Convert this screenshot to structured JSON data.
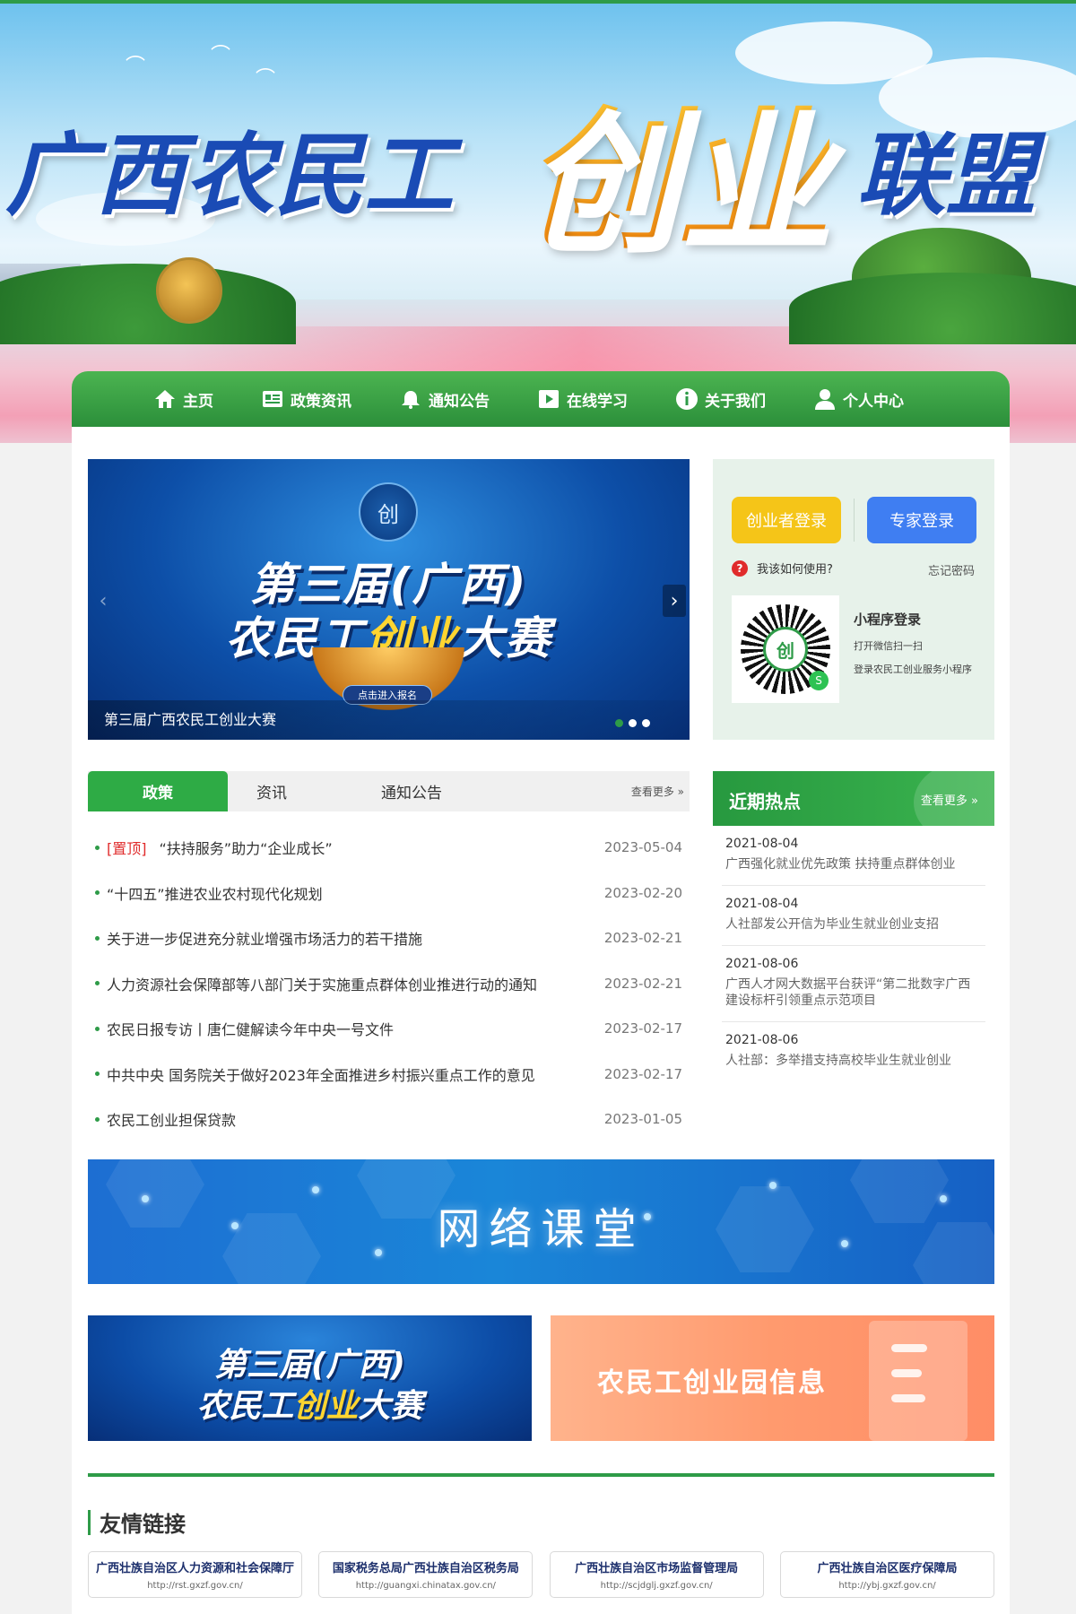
{
  "banner": {
    "title_blue_1": "广西农民工",
    "title_orange": "创业",
    "title_blue_2": "联盟"
  },
  "nav": {
    "items": [
      {
        "label": "主页",
        "icon": "home-icon"
      },
      {
        "label": "政策资讯",
        "icon": "news-icon"
      },
      {
        "label": "通知公告",
        "icon": "bell-icon"
      },
      {
        "label": "在线学习",
        "icon": "play-icon"
      },
      {
        "label": "关于我们",
        "icon": "info-icon"
      },
      {
        "label": "个人中心",
        "icon": "user-icon"
      }
    ]
  },
  "carousel": {
    "line1": "第三届(广西)",
    "line2_a": "农民工",
    "line2_b": "创业",
    "line2_c": "大赛",
    "enter_btn": "点击进入报名",
    "caption": "第三届广西农民工创业大赛",
    "slides": 3,
    "active_slide": 1
  },
  "login": {
    "entrepreneur_btn": "创业者登录",
    "expert_btn": "专家登录",
    "help": "我该如何使用?",
    "forgot": "忘记密码",
    "mini_title": "小程序登录",
    "mini_line1": "打开微信扫一扫",
    "mini_line2": "登录农民工创业服务小程序"
  },
  "tabs": {
    "items": [
      "政策",
      "资讯",
      "通知公告"
    ],
    "active": 0,
    "more": "查看更多 »"
  },
  "news": [
    {
      "pinned": "[置顶]",
      "title": "“扶持服务”助力“企业成长”",
      "date": "2023-05-04"
    },
    {
      "pinned": "",
      "title": "“十四五”推进农业农村现代化规划",
      "date": "2023-02-20"
    },
    {
      "pinned": "",
      "title": "关于进一步促进充分就业增强市场活力的若干措施",
      "date": "2023-02-21"
    },
    {
      "pinned": "",
      "title": "人力资源社会保障部等八部门关于实施重点群体创业推进行动的通知",
      "date": "2023-02-21"
    },
    {
      "pinned": "",
      "title": "农民日报专访丨唐仁健解读今年中央一号文件",
      "date": "2023-02-17"
    },
    {
      "pinned": "",
      "title": "中共中央 国务院关于做好2023年全面推进乡村振兴重点工作的意见",
      "date": "2023-02-17"
    },
    {
      "pinned": "",
      "title": "农民工创业担保贷款",
      "date": "2023-01-05"
    }
  ],
  "hot": {
    "title": "近期热点",
    "more": "查看更多 »",
    "items": [
      {
        "date": "2021-08-04",
        "title": "广西强化就业优先政策 扶持重点群体创业"
      },
      {
        "date": "2021-08-04",
        "title": "人社部发公开信为毕业生就业创业支招"
      },
      {
        "date": "2021-08-06",
        "title": "广西人才网大数据平台获评“第二批数字广西建设标杆引领重点示范项目"
      },
      {
        "date": "2021-08-06",
        "title": "人社部：多举措支持高校毕业生就业创业"
      }
    ]
  },
  "classroom": {
    "label": "网络课堂"
  },
  "contest_banner": {
    "line1": "第三届(广西)",
    "line2_a": "农民工",
    "line2_b": "创业",
    "line2_c": "大赛"
  },
  "park_banner": {
    "label": "农民工创业园信息"
  },
  "friend_links": {
    "title": "友情链接",
    "items": [
      {
        "name": "广西壮族自治区人力资源和社会保障厅",
        "url": "http://rst.gxzf.gov.cn/"
      },
      {
        "name": "国家税务总局广西壮族自治区税务局",
        "url": "http://guangxi.chinatax.gov.cn/"
      },
      {
        "name": "广西壮族自治区市场监督管理局",
        "url": "http://scjdglj.gxzf.gov.cn/"
      },
      {
        "name": "广西壮族自治区医疗保障局",
        "url": "http://ybj.gxzf.gov.cn/"
      }
    ]
  },
  "colors": {
    "brand_green": "#2e9b48",
    "accent_yellow": "#f5c518",
    "accent_blue": "#3f7ef2",
    "pinned_red": "#e02b2b"
  }
}
